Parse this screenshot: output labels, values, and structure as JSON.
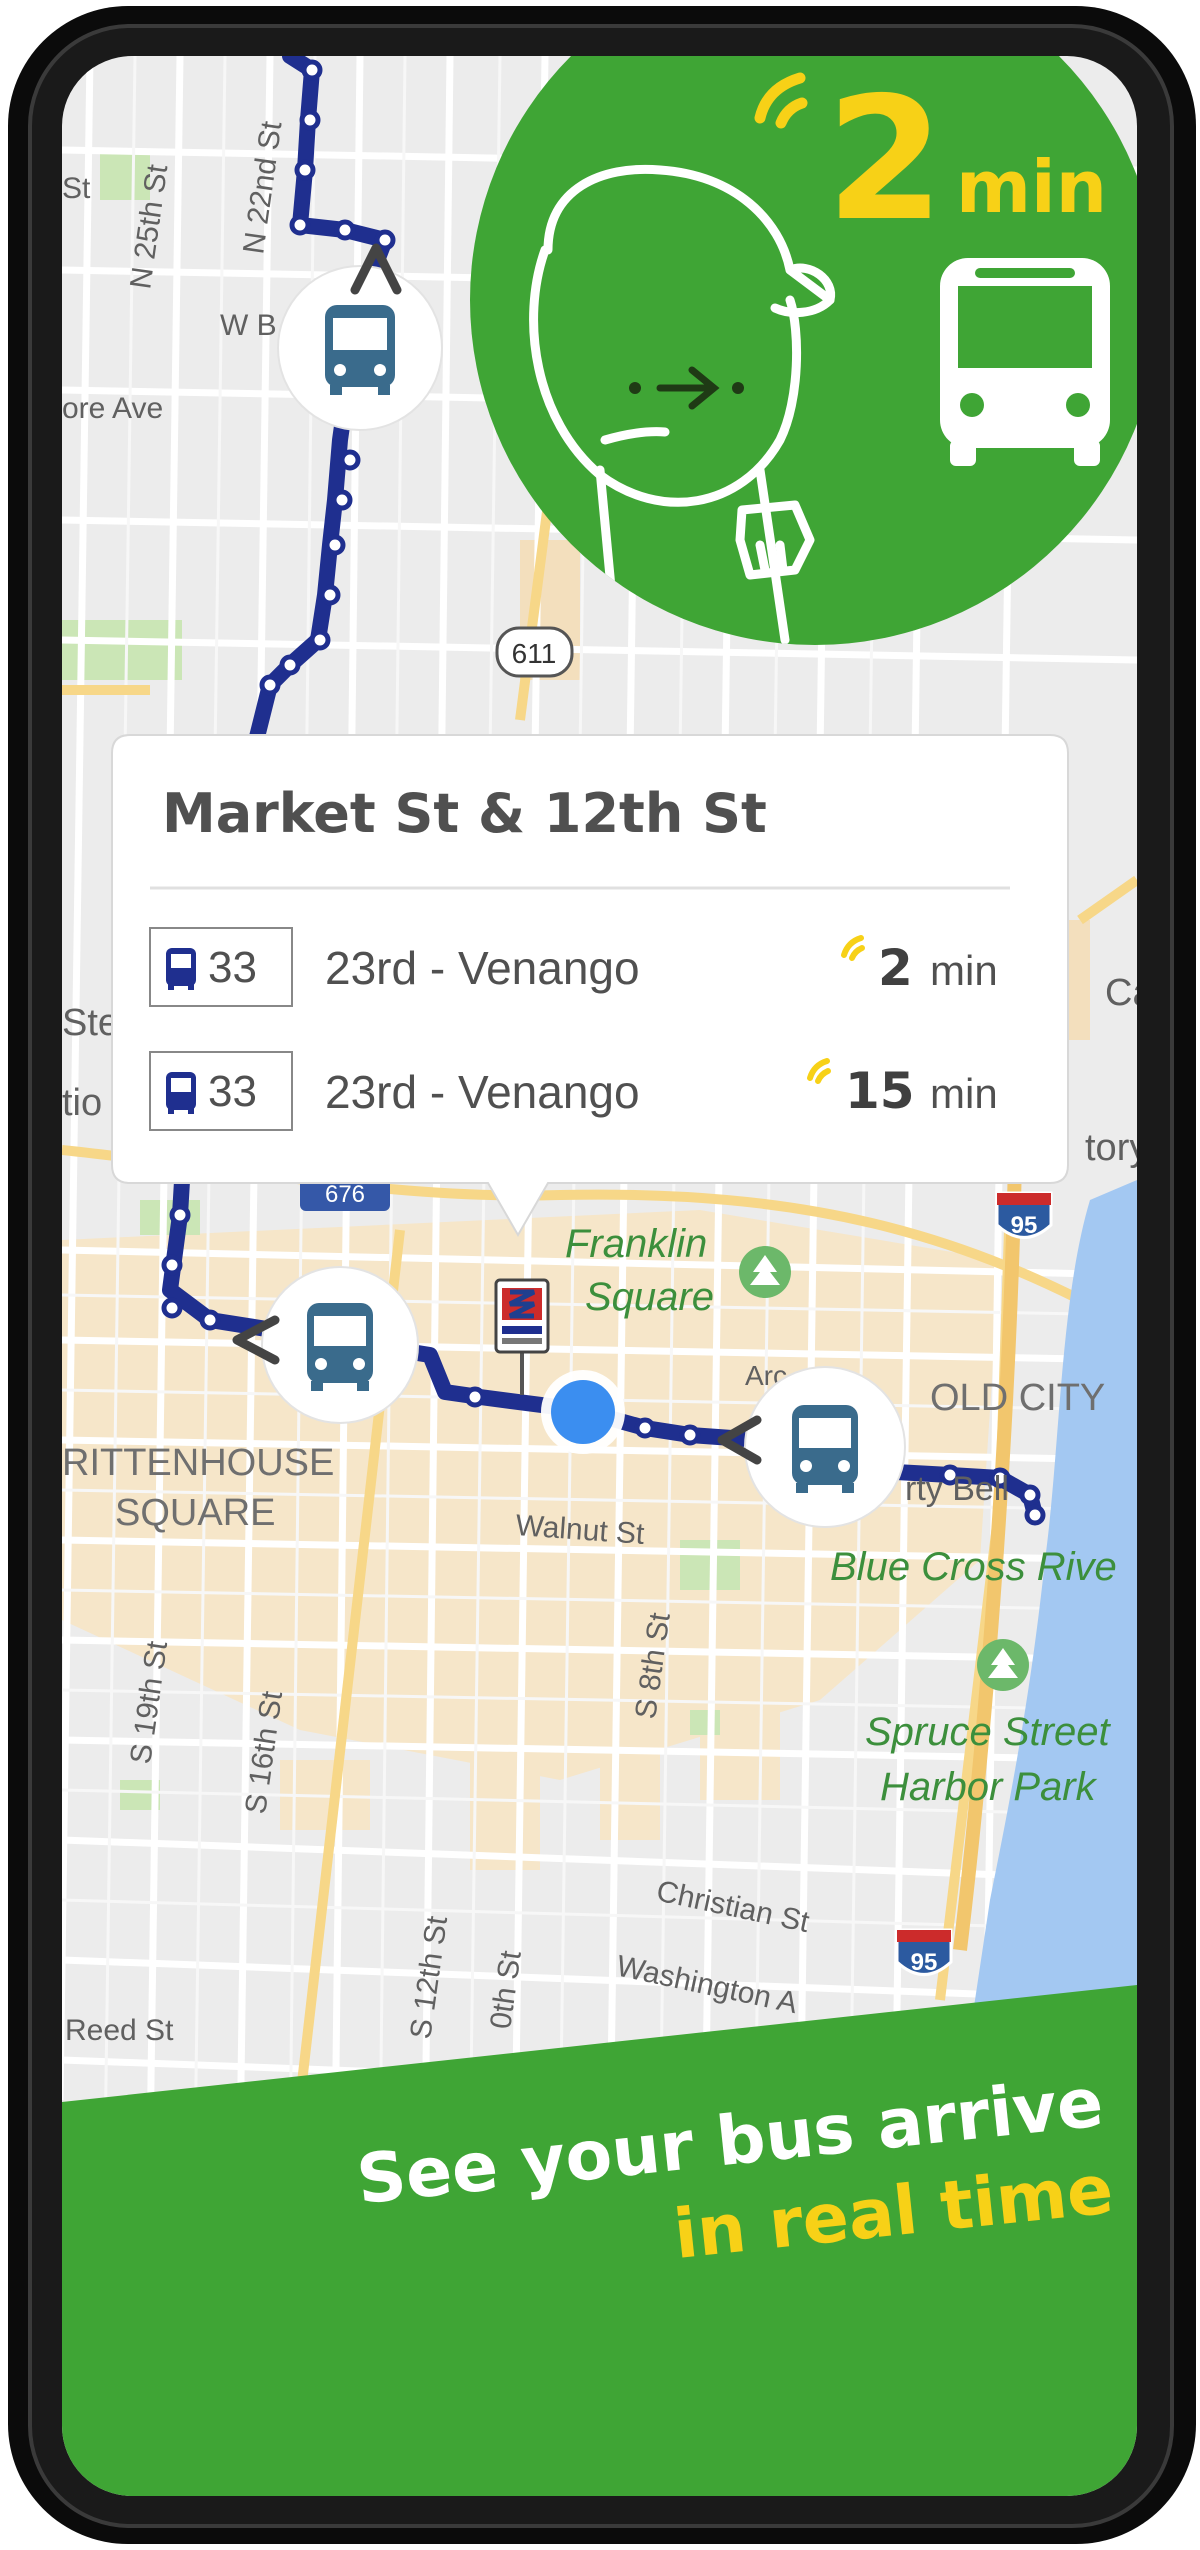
{
  "promo": {
    "eta_number": "2",
    "eta_unit": "min",
    "headline_line1": "See your bus arrive",
    "headline_line2": "in real time"
  },
  "stop_card": {
    "title": "Market St & 12th St",
    "departures": [
      {
        "route": "33",
        "destination": "23rd - Venango",
        "eta_value": "2",
        "eta_unit": "min"
      },
      {
        "route": "33",
        "destination": "23rd - Venango",
        "eta_value": "15",
        "eta_unit": "min"
      }
    ]
  },
  "map": {
    "labels": {
      "n_25th": "N 25th St",
      "n_22nd": "N 22nd St",
      "st_top": "St",
      "w_b": "W B",
      "ore_ave": "ore Ave",
      "hwy_611": "611",
      "franklin_square_1": "Franklin",
      "franklin_square_2": "Square",
      "rittenhouse_1": "RITTENHOUSE",
      "rittenhouse_2": "SQUARE",
      "walnut": "Walnut St",
      "s_8th": "S 8th St",
      "s_19th": "S 19th St",
      "s_16th": "S 16th St",
      "s_12th": "S 12th St",
      "s_10th": "0th St",
      "old_city": "OLD CITY",
      "liberty": "rty Bell",
      "blue_cross": "Blue Cross Rive",
      "spruce_1": "Spruce Street",
      "spruce_2": "Harbor Park",
      "christian": "Christian St",
      "washington": "Washington A",
      "reed": "Reed St",
      "i95_top": "95",
      "i95_bottom": "95",
      "cas": "Cas",
      "tory": "tory",
      "ste": "Ste",
      "tio": "tio",
      "arc": "Arc",
      "shield_partial": "676"
    }
  },
  "colors": {
    "brand_green": "#3fa535",
    "accent_yellow": "#f7d117",
    "route_blue": "#1f2f8f",
    "bus_icon": "#3a6b8c",
    "user_dot": "#3b8ef0"
  }
}
